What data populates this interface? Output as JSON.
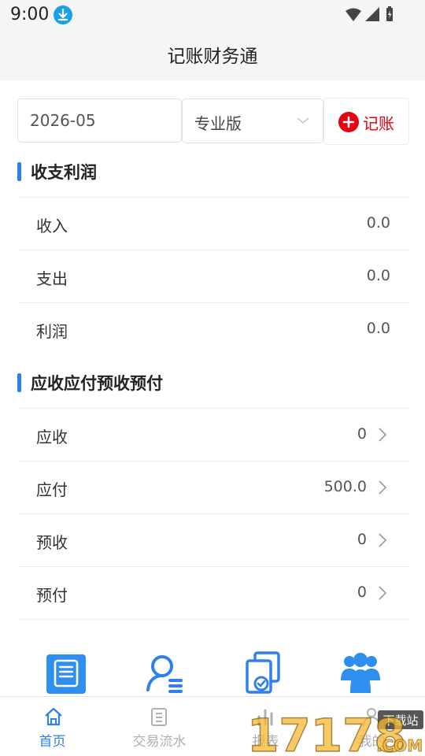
{
  "status_bar": {
    "time": "9:00"
  },
  "header": {
    "title": "记账财务通"
  },
  "filters": {
    "date": "2026-05",
    "edition": "专业版",
    "add_label": "记账"
  },
  "profit_section": {
    "title": "收支利润",
    "rows": [
      {
        "label": "收入",
        "value": "0.0"
      },
      {
        "label": "支出",
        "value": "0.0"
      },
      {
        "label": "利润",
        "value": "0.0"
      }
    ]
  },
  "receivable_section": {
    "title": "应收应付预收预付",
    "rows": [
      {
        "label": "应收",
        "value": "0"
      },
      {
        "label": "应付",
        "value": "500.0"
      },
      {
        "label": "预收",
        "value": "0"
      },
      {
        "label": "预付",
        "value": "0"
      }
    ]
  },
  "quick_icons": [
    "ledger-icon",
    "user-list-icon",
    "documents-check-icon",
    "team-icon"
  ],
  "tabs": [
    {
      "label": "首页",
      "icon": "home-icon",
      "active": true
    },
    {
      "label": "交易流水",
      "icon": "clipboard-icon",
      "active": false
    },
    {
      "label": "报表",
      "icon": "report-icon",
      "active": false
    },
    {
      "label": "我的",
      "icon": "person-icon",
      "active": false
    }
  ],
  "watermark": {
    "text": "17178",
    "badge_top": "下载站",
    "badge_bottom": ".COM"
  },
  "colors": {
    "accent": "#2f80ed",
    "brand_red": "#e60012",
    "inactive": "#b0b0b0"
  }
}
